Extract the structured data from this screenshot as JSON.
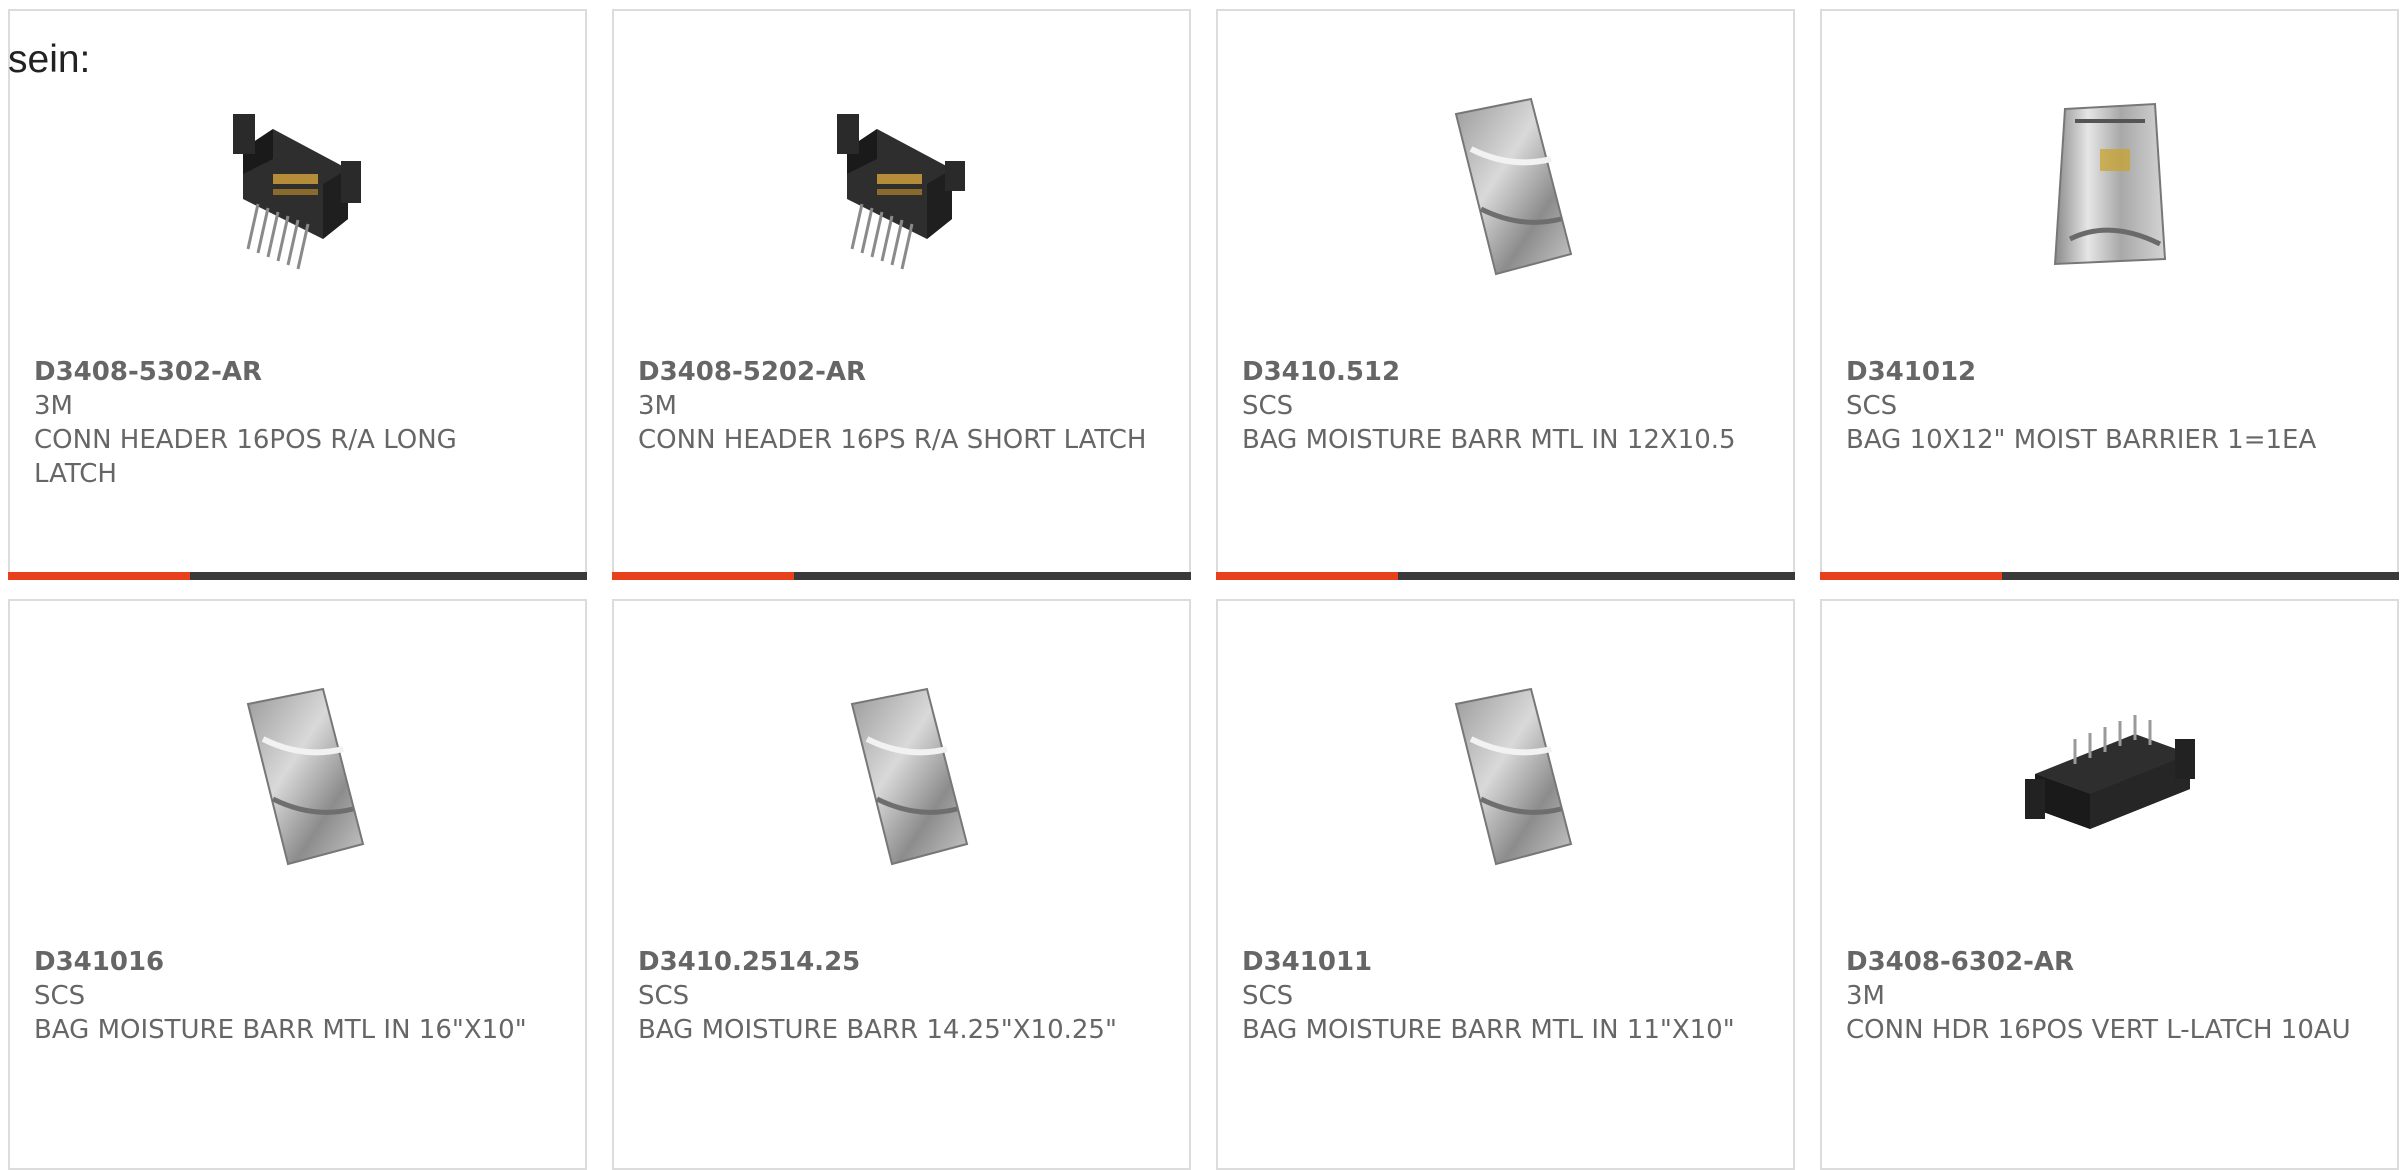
{
  "lead_text": "sein:",
  "products": [
    {
      "part": "D3408-5302-AR",
      "mfr": "3M",
      "desc": "CONN HEADER 16POS R/A LONG LATCH",
      "icon": "connector-ra-icon"
    },
    {
      "part": "D3408-5202-AR",
      "mfr": "3M",
      "desc": "CONN HEADER 16PS R/A SHORT LATCH",
      "icon": "connector-ra-icon"
    },
    {
      "part": "D3410.512",
      "mfr": "SCS",
      "desc": "BAG MOISTURE BARR MTL IN 12X10.5",
      "icon": "bag-icon"
    },
    {
      "part": "D341012",
      "mfr": "SCS",
      "desc": "BAG 10X12\" MOIST BARRIER 1=1EA",
      "icon": "bag-open-icon"
    },
    {
      "part": "D341016",
      "mfr": "SCS",
      "desc": "BAG MOISTURE BARR MTL IN 16\"X10\"",
      "icon": "bag-icon"
    },
    {
      "part": "D3410.2514.25",
      "mfr": "SCS",
      "desc": "BAG MOISTURE BARR 14.25\"X10.25\"",
      "icon": "bag-icon"
    },
    {
      "part": "D341011",
      "mfr": "SCS",
      "desc": "BAG MOISTURE BARR MTL IN 11\"X10\"",
      "icon": "bag-icon"
    },
    {
      "part": "D3408-6302-AR",
      "mfr": "3M",
      "desc": "CONN HDR 16POS VERT L-LATCH 10AU",
      "icon": "connector-vert-icon"
    }
  ],
  "colors": {
    "accent": "#e8401c",
    "bar": "#3a3a3a",
    "text": "#666666",
    "border": "#dcdcdc"
  }
}
